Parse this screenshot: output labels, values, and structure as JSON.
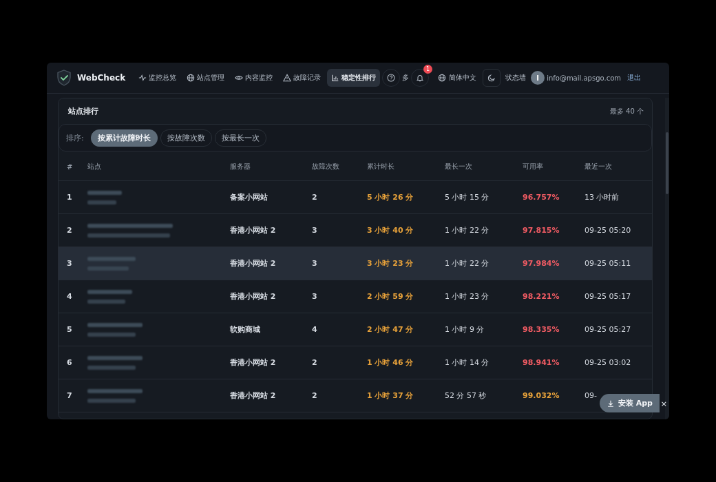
{
  "header": {
    "brand": "WebCheck",
    "nav": [
      {
        "label": "监控总览",
        "selected": false
      },
      {
        "label": "站点管理",
        "selected": false
      },
      {
        "label": "内容监控",
        "selected": false
      },
      {
        "label": "故障记录",
        "selected": false
      },
      {
        "label": "稳定性排行",
        "selected": true
      }
    ],
    "more_label": "多",
    "notification_count": "1",
    "language": "简体中文",
    "status_wall": "状态墙",
    "avatar_letter": "I",
    "email": "info@mail.apsgo.com",
    "logout": "退出"
  },
  "panel": {
    "title": "站点排行",
    "limit_note": "最多 40 个",
    "sort_label": "排序:",
    "sort_options": [
      {
        "label": "按累计故障时长",
        "selected": true
      },
      {
        "label": "按故障次数",
        "selected": false
      },
      {
        "label": "按最长一次",
        "selected": false
      }
    ],
    "table": {
      "columns": [
        "#",
        "站点",
        "服务器",
        "故障次数",
        "累计时长",
        "最长一次",
        "可用率",
        "最近一次"
      ],
      "rows": [
        {
          "rank": "1",
          "server": "备案小网站",
          "failures": "2",
          "total": "5 小时 26 分",
          "longest": "5 小时 15 分",
          "uptime": "96.757%",
          "color": "#f05b63",
          "latest": "13 小时前",
          "selected": false
        },
        {
          "rank": "2",
          "server": "香港小网站 2",
          "failures": "3",
          "total": "3 小时 40 分",
          "longest": "1 小时 22 分",
          "uptime": "97.815%",
          "color": "#f05b63",
          "latest": "09-25 05:20",
          "selected": false
        },
        {
          "rank": "3",
          "server": "香港小网站 2",
          "failures": "3",
          "total": "3 小时 23 分",
          "longest": "1 小时 22 分",
          "uptime": "97.984%",
          "color": "#f05b63",
          "latest": "09-25 05:11",
          "selected": true
        },
        {
          "rank": "4",
          "server": "香港小网站 2",
          "failures": "3",
          "total": "2 小时 59 分",
          "longest": "1 小时 23 分",
          "uptime": "98.221%",
          "color": "#f05b63",
          "latest": "09-25 05:17",
          "selected": false
        },
        {
          "rank": "5",
          "server": "软购商城",
          "failures": "4",
          "total": "2 小时 47 分",
          "longest": "1 小时 9 分",
          "uptime": "98.335%",
          "color": "#f05b63",
          "latest": "09-25 05:27",
          "selected": false
        },
        {
          "rank": "6",
          "server": "香港小网站 2",
          "failures": "2",
          "total": "1 小时 46 分",
          "longest": "1 小时 14 分",
          "uptime": "98.941%",
          "color": "#f05b63",
          "latest": "09-25 03:02",
          "selected": false
        },
        {
          "rank": "7",
          "server": "香港小网站 2",
          "failures": "2",
          "total": "1 小时 37 分",
          "longest": "52 分 57 秒",
          "uptime": "99.032%",
          "color": "#e8a23a",
          "latest": "09-",
          "selected": false
        }
      ]
    }
  },
  "install_prompt": {
    "label": "安装 App",
    "close": "×"
  }
}
